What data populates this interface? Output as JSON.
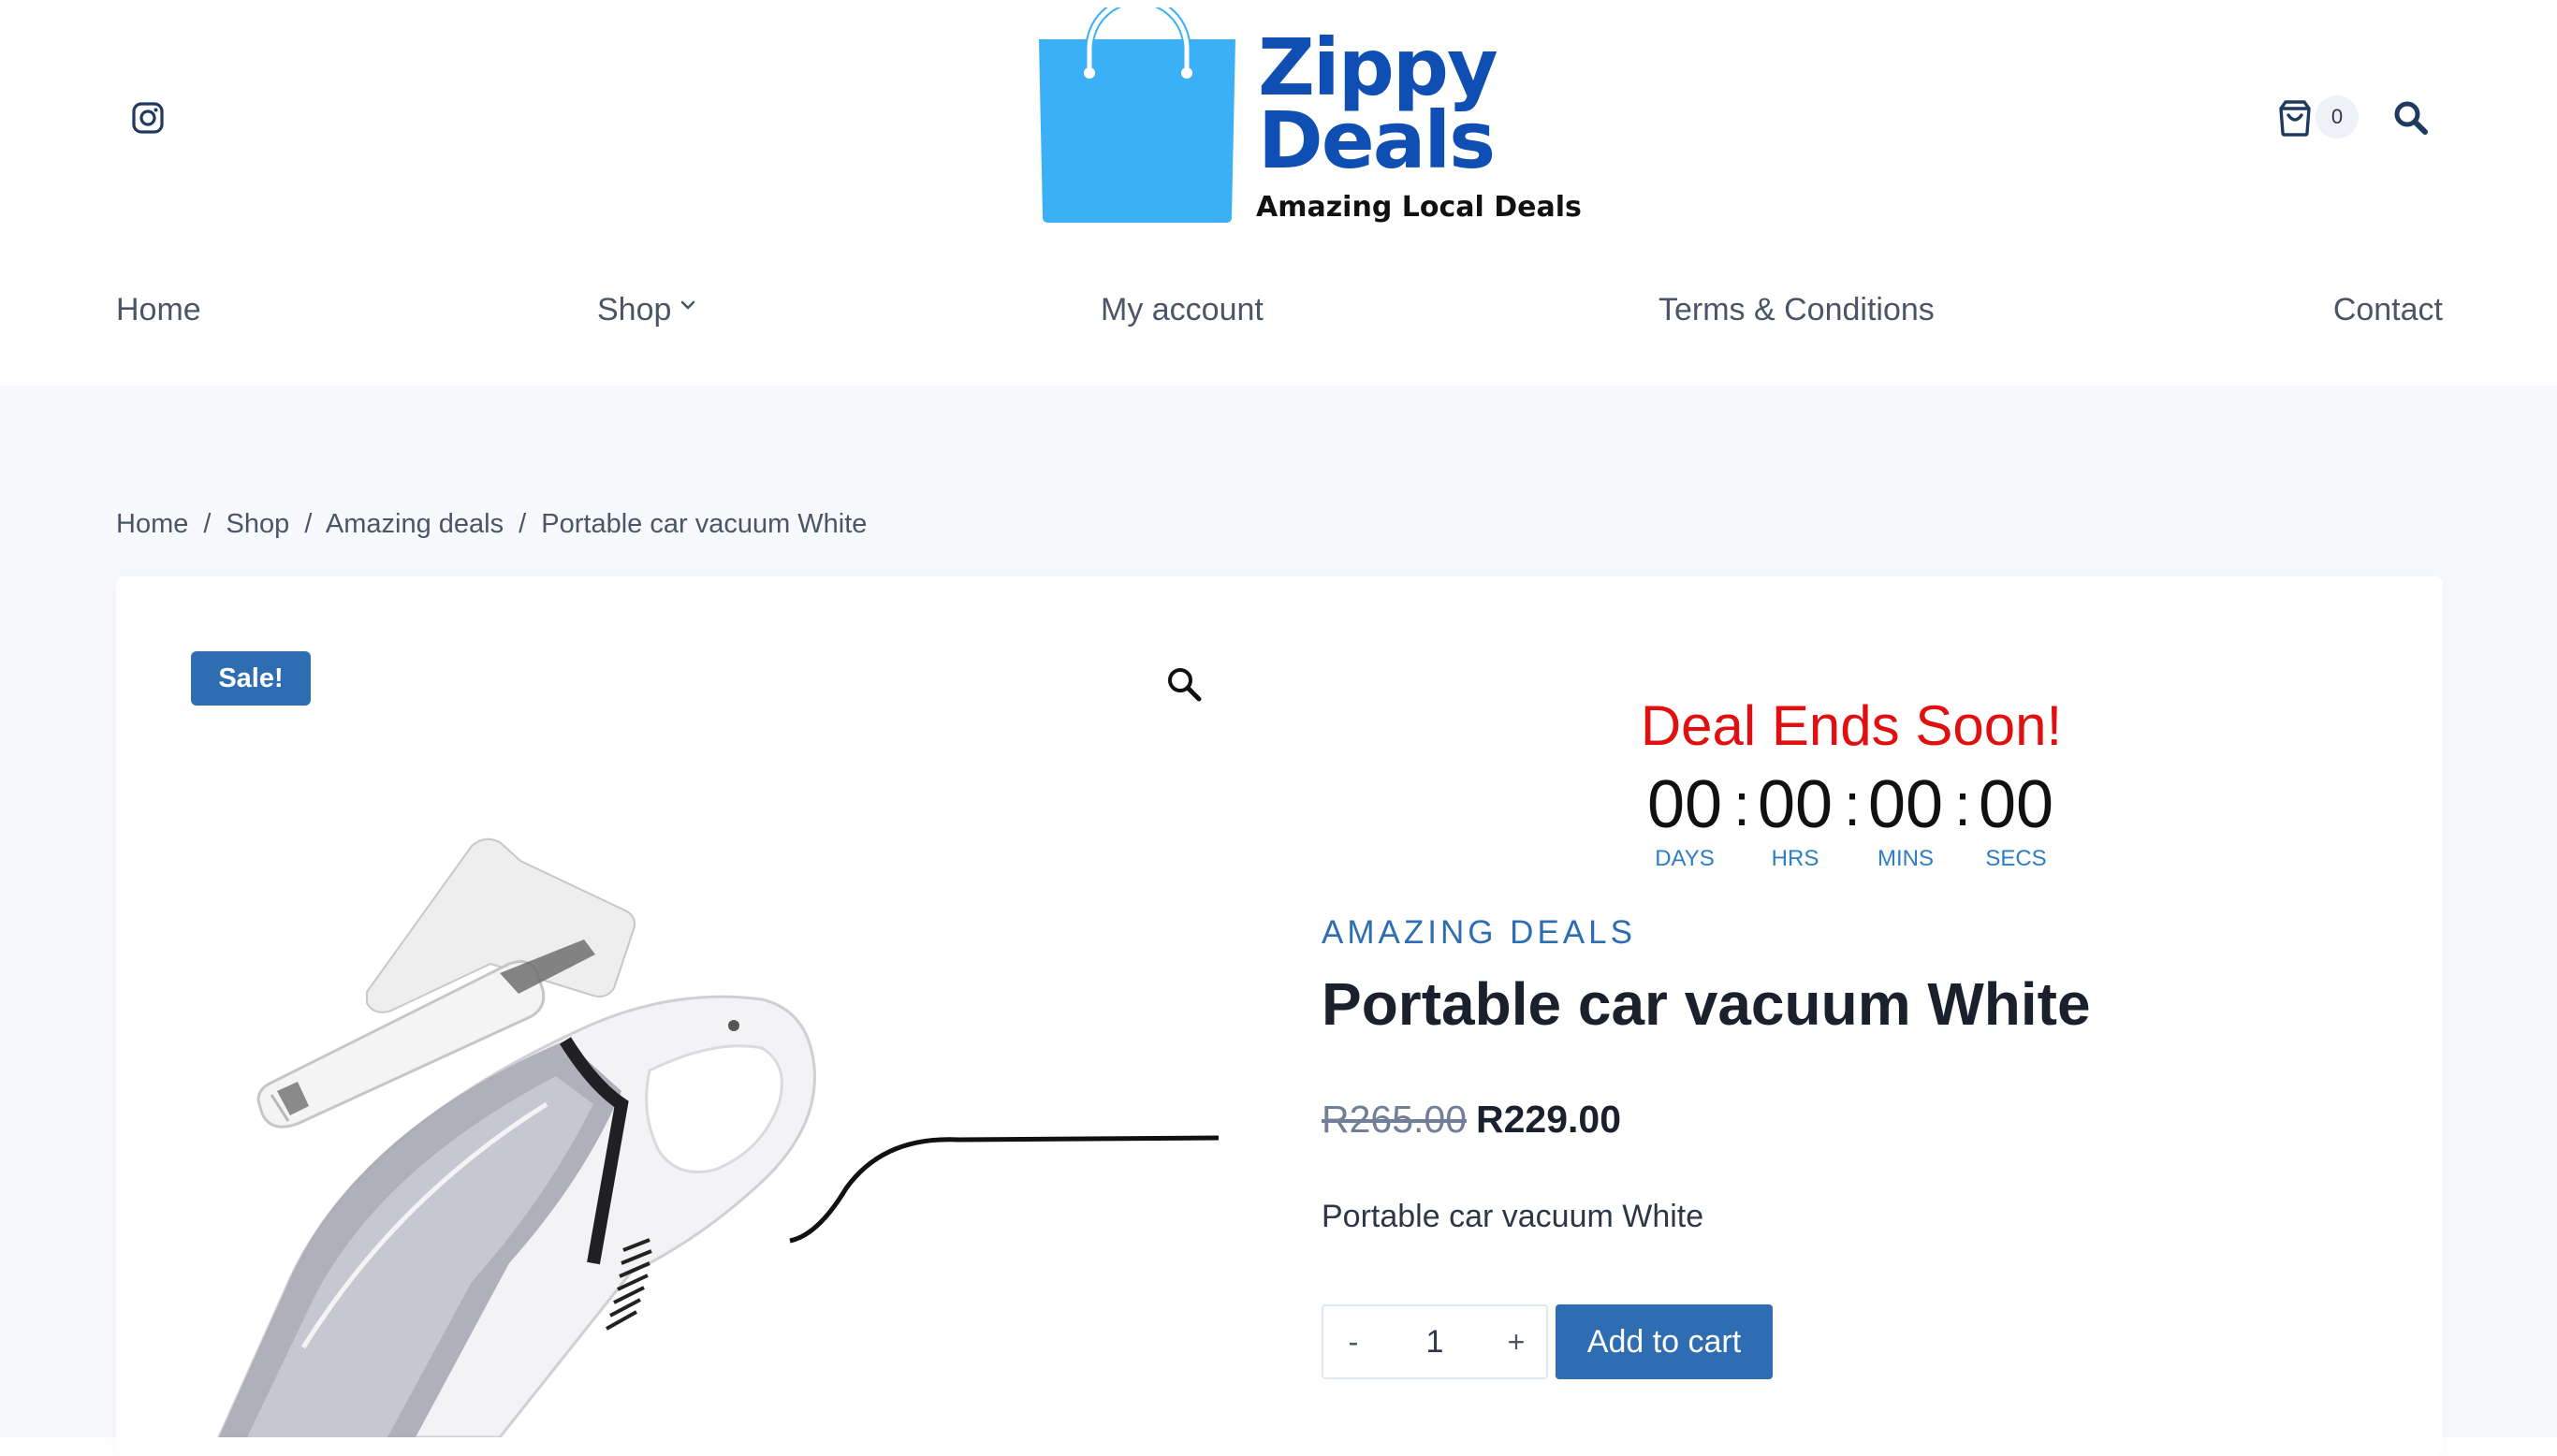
{
  "header": {
    "logo": {
      "word1": "Zippy",
      "word2": "Deals",
      "tagline": "Amazing Local Deals"
    },
    "cart_count": "0",
    "icons": {
      "social": "instagram-icon",
      "cart": "cart-icon",
      "search": "search-icon"
    },
    "colors": {
      "logo_blue": "#0f4fb3",
      "bag_blue": "#3bb0f7"
    }
  },
  "nav": {
    "home": "Home",
    "shop": "Shop",
    "account": "My account",
    "terms": "Terms & Conditions",
    "contact": "Contact"
  },
  "breadcrumb": {
    "home": "Home",
    "shop": "Shop",
    "category": "Amazing deals",
    "current": "Portable car vacuum White",
    "separator": "/"
  },
  "product": {
    "sale_badge": "Sale!",
    "deal_heading": "Deal Ends Soon!",
    "countdown": {
      "days": "00",
      "days_label": "DAYS",
      "hours": "00",
      "hours_label": "HRS",
      "mins": "00",
      "mins_label": "MINS",
      "secs": "00",
      "secs_label": "SECS",
      "colon": ":"
    },
    "category": "AMAZING DEALS",
    "title": "Portable car vacuum White",
    "price_old": "R265.00",
    "price_new": "R229.00",
    "description": "Portable car vacuum White",
    "quantity": {
      "minus": "-",
      "value": "1",
      "plus": "+"
    },
    "add_to_cart": "Add to cart",
    "colors": {
      "accent": "#2f6db3",
      "deal_red": "#e01010"
    }
  }
}
